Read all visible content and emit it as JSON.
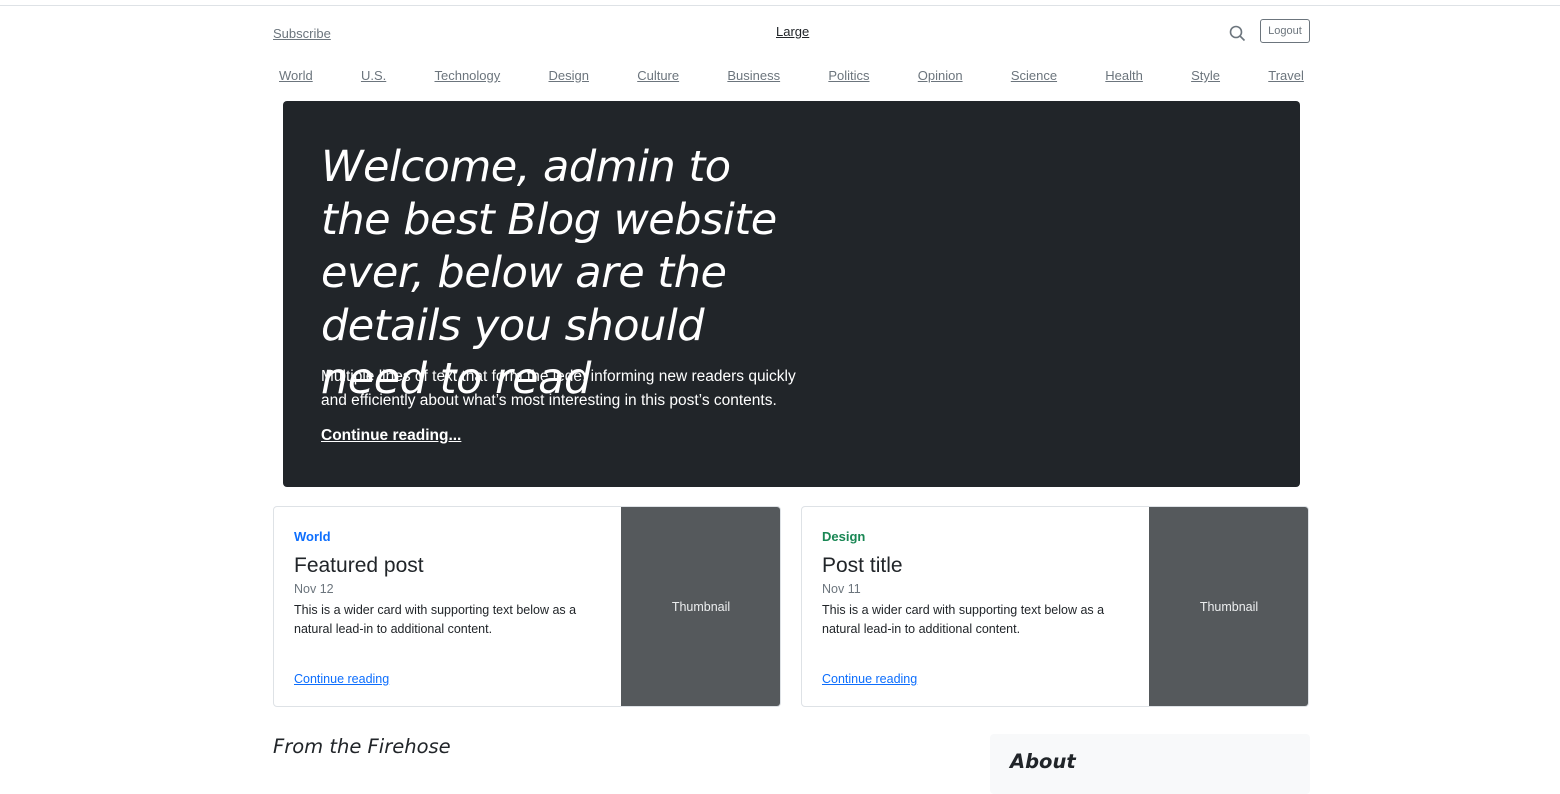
{
  "header": {
    "subscribe_label": "Subscribe",
    "brand_label": "Large",
    "logout_label": "Logout"
  },
  "nav": {
    "items": [
      "World",
      "U.S.",
      "Technology",
      "Design",
      "Culture",
      "Business",
      "Politics",
      "Opinion",
      "Science",
      "Health",
      "Style",
      "Travel"
    ]
  },
  "hero": {
    "title": "Welcome, admin to the best Blog website ever, below are the details you should need to read",
    "lede": "Multiple lines of text that form the lede, informing new readers quickly and efficiently about what’s most interesting in this post’s contents.",
    "link_label": "Continue reading..."
  },
  "cards": [
    {
      "category": "World",
      "category_color": "#0d6efd",
      "title": "Featured post",
      "date": "Nov 12",
      "text": "This is a wider card with supporting text below as a natural lead-in to additional content.",
      "link_label": "Continue reading",
      "thumbnail_label": "Thumbnail"
    },
    {
      "category": "Design",
      "category_color": "#198754",
      "title": "Post title",
      "date": "Nov 11",
      "text": "This is a wider card with supporting text below as a natural lead-in to additional content.",
      "link_label": "Continue reading",
      "thumbnail_label": "Thumbnail"
    }
  ],
  "main": {
    "section_heading": "From the Firehose"
  },
  "sidebar": {
    "about_title": "About"
  },
  "colors": {
    "hero_bg": "#212529",
    "thumb_bg": "#55595c",
    "link": "#0d6efd",
    "muted": "#6c757d"
  }
}
